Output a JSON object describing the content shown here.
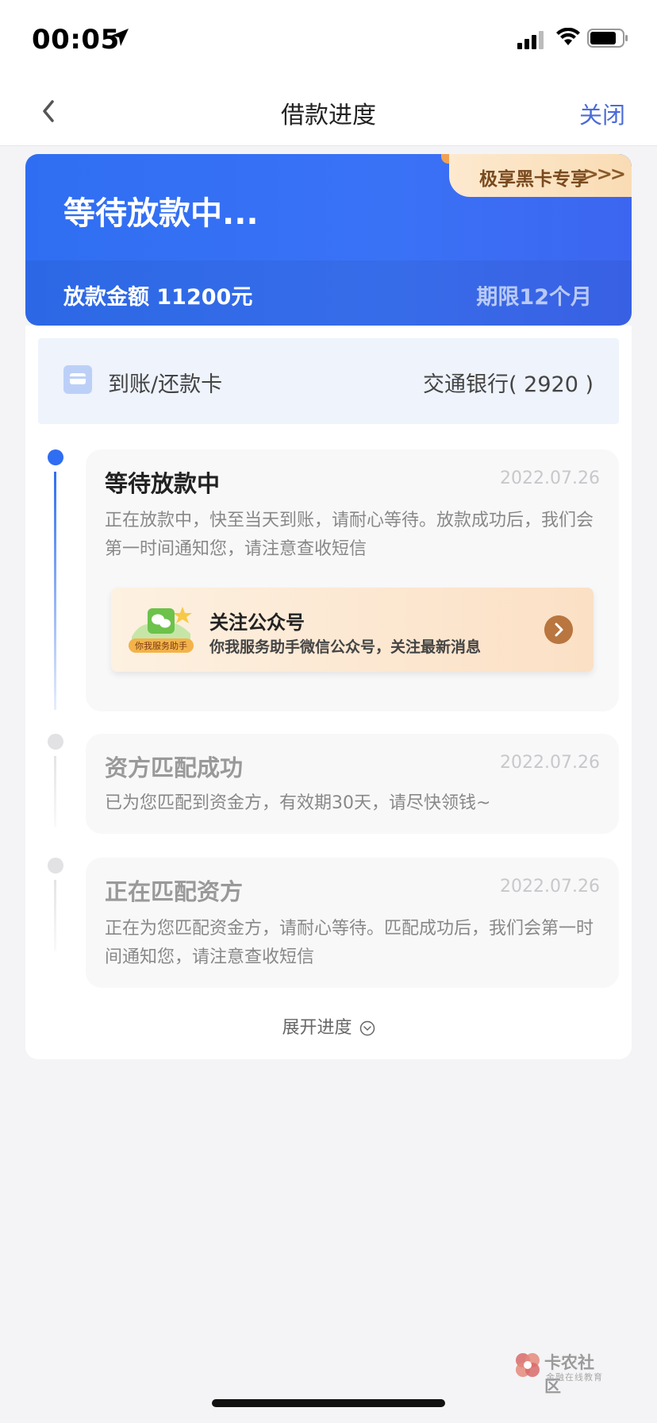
{
  "status_bar": {
    "time": "00:05",
    "icons": [
      "location-arrow-icon",
      "cellular-signal-icon",
      "wifi-icon",
      "battery-icon"
    ]
  },
  "nav": {
    "back_icon": "chevron-left-icon",
    "title": "借款进度",
    "close_label": "关闭"
  },
  "status_card": {
    "title": "等待放款中...",
    "amount_text": "放款金额 11200元",
    "term_text": "期限12个月",
    "vip_label": "极享黑卡专享",
    "vip_arrows": ">>>"
  },
  "bank": {
    "icon": "bank-card-icon",
    "label": "到账/还款卡",
    "value": "交通银行( 2920 )"
  },
  "timeline": [
    {
      "state": "active",
      "title": "等待放款中",
      "date": "2022.07.26",
      "desc": "正在放款中，快至当天到账，请耐心等待。放款成功后，我们会第一时间通知您，请注意查收短信"
    },
    {
      "state": "inactive",
      "title": "资方匹配成功",
      "date": "2022.07.26",
      "desc": "已为您匹配到资金方，有效期30天，请尽快领钱~"
    },
    {
      "state": "inactive",
      "title": "正在匹配资方",
      "date": "2022.07.26",
      "desc": "正在为您匹配资金方，请耐心等待。匹配成功后，我们会第一时间通知您，请注意查收短信"
    }
  ],
  "follow": {
    "icon_badge": "你我服务助手",
    "title": "关注公众号",
    "desc": "你我服务助手微信公众号，关注最新消息",
    "arrow_icon": "chevron-right-circle-icon"
  },
  "expand_label": "展开进度",
  "watermark": {
    "name": "卡农社区",
    "sub": "金融在线教育"
  },
  "colors": {
    "accent_blue": "#2f6ef2",
    "close_blue": "#4a6bd8",
    "vip_gold": "#7a4a1e",
    "follow_arrow": "#b9763f"
  }
}
